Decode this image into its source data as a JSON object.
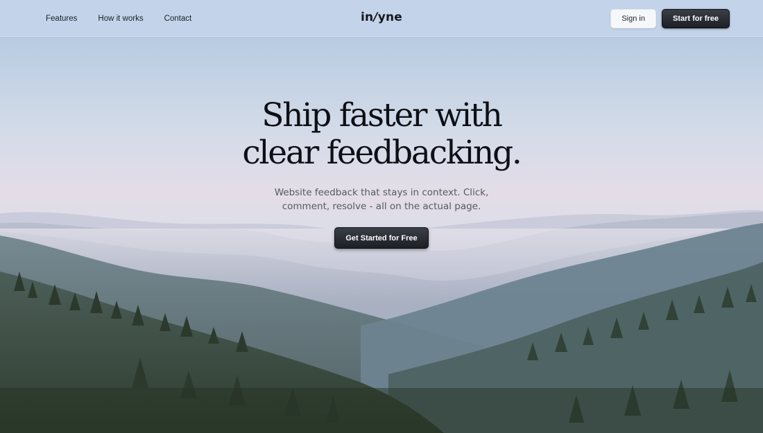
{
  "nav": {
    "links": [
      {
        "label": "Features"
      },
      {
        "label": "How it works"
      },
      {
        "label": "Contact"
      }
    ],
    "logo_prefix": "in",
    "logo_slash": "/",
    "logo_suffix": "yne",
    "signin_label": "Sign in",
    "start_label": "Start for free"
  },
  "hero": {
    "headline_line1": "Ship faster with",
    "headline_line2": "clear feedbacking.",
    "subhead": "Website feedback that stays in context. Click, comment, resolve - all on the actual page.",
    "cta_label": "Get Started for Free"
  },
  "colors": {
    "nav_background": "#c3d4ea",
    "primary_button": "#1d2025",
    "secondary_button": "#f6f7f9",
    "headline_text": "#0d1015",
    "subhead_text": "#545a63"
  }
}
